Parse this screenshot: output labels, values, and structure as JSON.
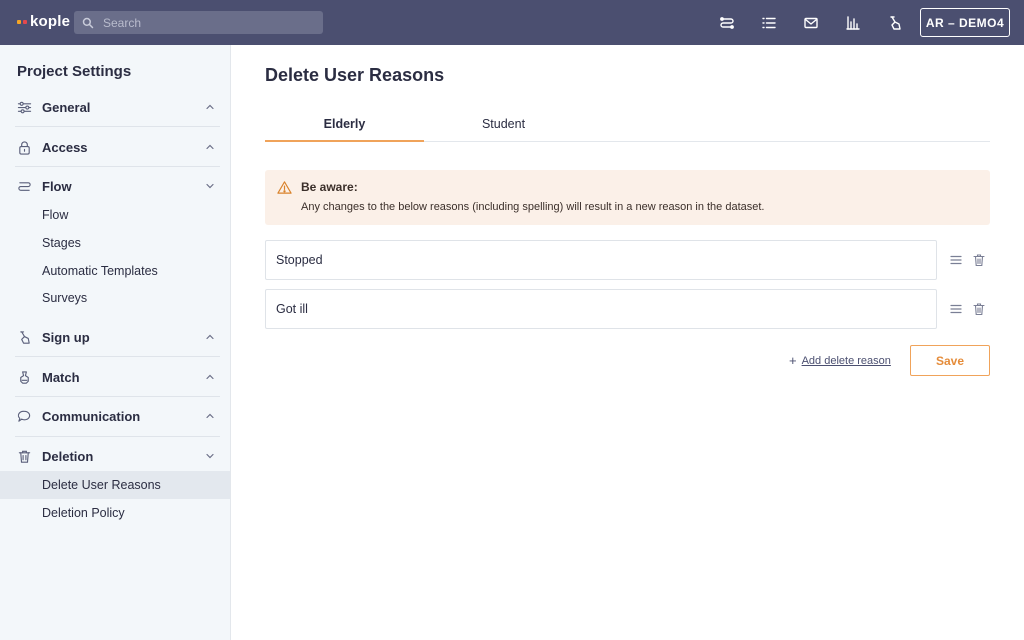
{
  "colors": {
    "topbar": "#4b4f70",
    "sidebar_bg": "#f3f7fa",
    "accent": "#f0a35a",
    "alert_bg": "#fbf0e8",
    "logo_dot_1": "#f5a524",
    "logo_dot_2": "#e5484d"
  },
  "header": {
    "logo": "kople",
    "search_placeholder": "Search",
    "icons": [
      "flow-icon",
      "list-icon",
      "mail-icon",
      "chart-icon",
      "signup-icon"
    ],
    "account_label": "AR – DEMO4"
  },
  "sidebar": {
    "title": "Project Settings",
    "sections": [
      {
        "label": "General",
        "icon": "sliders-icon",
        "expanded": false
      },
      {
        "label": "Access",
        "icon": "lock-icon",
        "expanded": false
      },
      {
        "label": "Flow",
        "icon": "flow-icon",
        "expanded": true,
        "items": [
          "Flow",
          "Stages",
          "Automatic Templates",
          "Surveys"
        ]
      },
      {
        "label": "Sign up",
        "icon": "signup-icon",
        "expanded": false
      },
      {
        "label": "Match",
        "icon": "match-icon",
        "expanded": false
      },
      {
        "label": "Communication",
        "icon": "chat-icon",
        "expanded": false
      },
      {
        "label": "Deletion",
        "icon": "trash-icon",
        "expanded": true,
        "items": [
          "Delete User Reasons",
          "Deletion Policy"
        ],
        "active_item": "Delete User Reasons"
      }
    ]
  },
  "main": {
    "title": "Delete User Reasons",
    "tabs": [
      {
        "label": "Elderly",
        "active": true
      },
      {
        "label": "Student",
        "active": false
      }
    ],
    "alert": {
      "title": "Be aware:",
      "text": "Any changes to the below reasons (including spelling) will result in a new reason in the dataset."
    },
    "reasons": [
      "Stopped",
      "Got ill"
    ],
    "add_label": "Add delete reason",
    "save_label": "Save"
  }
}
